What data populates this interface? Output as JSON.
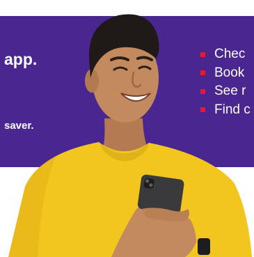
{
  "banner": {
    "headline": "app.",
    "subline": "saver.",
    "background_color": "#4a2690",
    "bullet_color": "#e8192c",
    "features": [
      {
        "label": "Chec"
      },
      {
        "label": "Book"
      },
      {
        "label": "See r"
      },
      {
        "label": "Find c"
      }
    ]
  },
  "photo": {
    "subject": "smiling man in yellow t-shirt holding a smartphone",
    "shirt_color": "#f2c51f",
    "phone_icon": "smartphone-icon",
    "watch_icon": "smartwatch-icon"
  }
}
